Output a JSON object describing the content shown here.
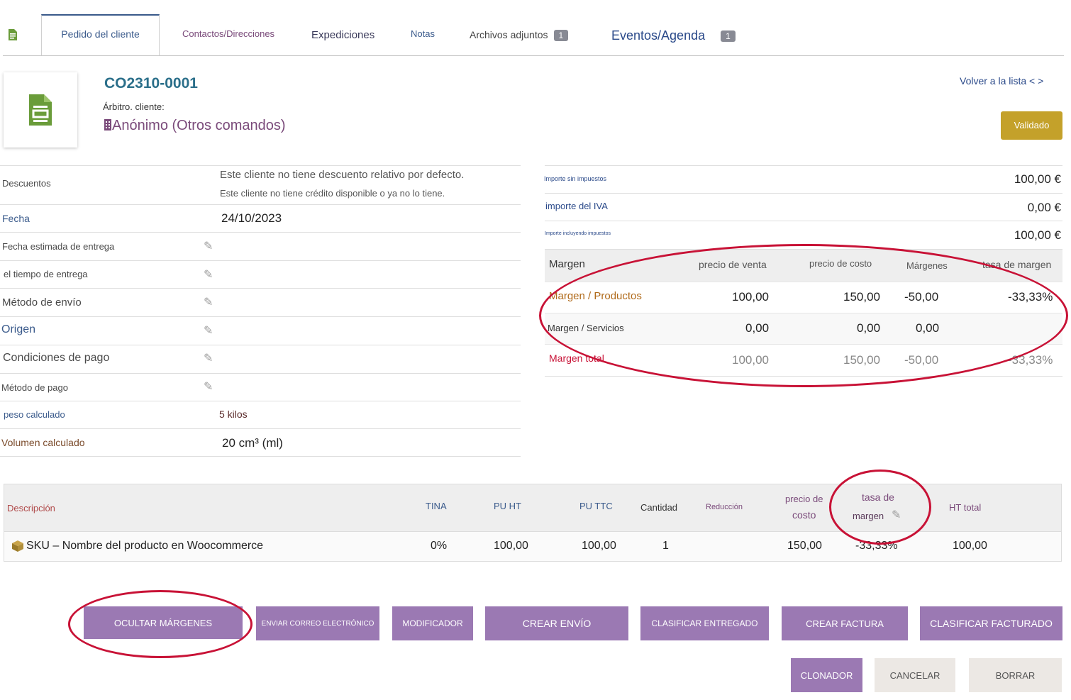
{
  "tabs": {
    "active": "Pedido del cliente",
    "contacts": "Contactos/Direcciones",
    "shipments": "Expediciones",
    "notes": "Notas",
    "attachments": "Archivos adjuntos",
    "attachments_count": "1",
    "events": "Eventos/Agenda",
    "events_count": "1"
  },
  "header": {
    "ref": "CO2310-0001",
    "ref_client_label": "Árbitro. cliente:",
    "company": "Anónimo (Otros comandos)",
    "back_link": "Volver a la lista < >",
    "status": "Validado",
    "status_color": "#c4a12a"
  },
  "fields": {
    "discounts_label": "Descuentos",
    "discounts_line1": "Este cliente no tiene descuento relativo por defecto.",
    "discounts_line2": "Este cliente no tiene crédito disponible o ya no lo tiene.",
    "date_label": "Fecha",
    "date_value": "24/10/2023",
    "est_delivery_label": "Fecha estimada de entrega",
    "delivery_time_label": "el tiempo de entrega",
    "ship_method_label": "Método de envío",
    "origin_label": "Origen",
    "payment_terms_label": "Condiciones de pago",
    "payment_method_label": "Método de pago",
    "weight_label": "peso calculado",
    "weight_value": "5 kilos",
    "volume_label": "Volumen calculado",
    "volume_value": "20 cm³ (ml)"
  },
  "totals": {
    "ht_label": "Importe sin impuestos",
    "ht_value": "100,00 €",
    "vat_label": "importe del IVA",
    "vat_value": "0,00 €",
    "ttc_label": "Importe incluyendo impuestos",
    "ttc_value": "100,00 €"
  },
  "margin_table": {
    "headers": [
      "Margen",
      "precio de venta",
      "precio de costo",
      "Márgenes",
      "tasa de margen"
    ],
    "rows": [
      {
        "label": "Margen / Productos",
        "sell": "100,00",
        "cost": "150,00",
        "margin": "-50,00",
        "rate": "-33,33%"
      },
      {
        "label": "Margen / Servicios",
        "sell": "0,00",
        "cost": "0,00",
        "margin": "0,00",
        "rate": ""
      },
      {
        "label": "Margen total",
        "sell": "100,00",
        "cost": "150,00",
        "margin": "-50,00",
        "rate": "-33,33%"
      }
    ]
  },
  "lines": {
    "headers": {
      "desc": "Descripción",
      "vat": "TINA",
      "pu_ht": "PU HT",
      "pu_ttc": "PU TTC",
      "qty": "Cantidad",
      "discount": "Reducción",
      "cost_1": "precio de",
      "cost_2": "costo",
      "rate_1": "tasa de",
      "rate_2": "margen",
      "total_ht": "HT total"
    },
    "row": {
      "desc": "SKU – Nombre del producto en Woocommerce",
      "vat": "0%",
      "pu_ht": "100,00",
      "pu_ttc": "100,00",
      "qty": "1",
      "cost": "150,00",
      "rate": "-33,33%",
      "total": "100,00"
    }
  },
  "actions": {
    "hide_margins": "OCULTAR MÁRGENES",
    "send_email": "ENVIAR CORREO ELECTRÓNICO",
    "modify": "MODIFICADOR",
    "create_shipment": "CREAR ENVÍO",
    "classify_delivered": "CLASIFICAR ENTREGADO",
    "create_invoice": "CREAR FACTURA",
    "classify_billed": "CLASIFICAR FACTURADO",
    "clone": "CLONADOR",
    "cancel": "CANCELAR",
    "delete": "BORRAR"
  },
  "colors": {
    "button": "#9b79b3",
    "highlight": "#c81236"
  }
}
